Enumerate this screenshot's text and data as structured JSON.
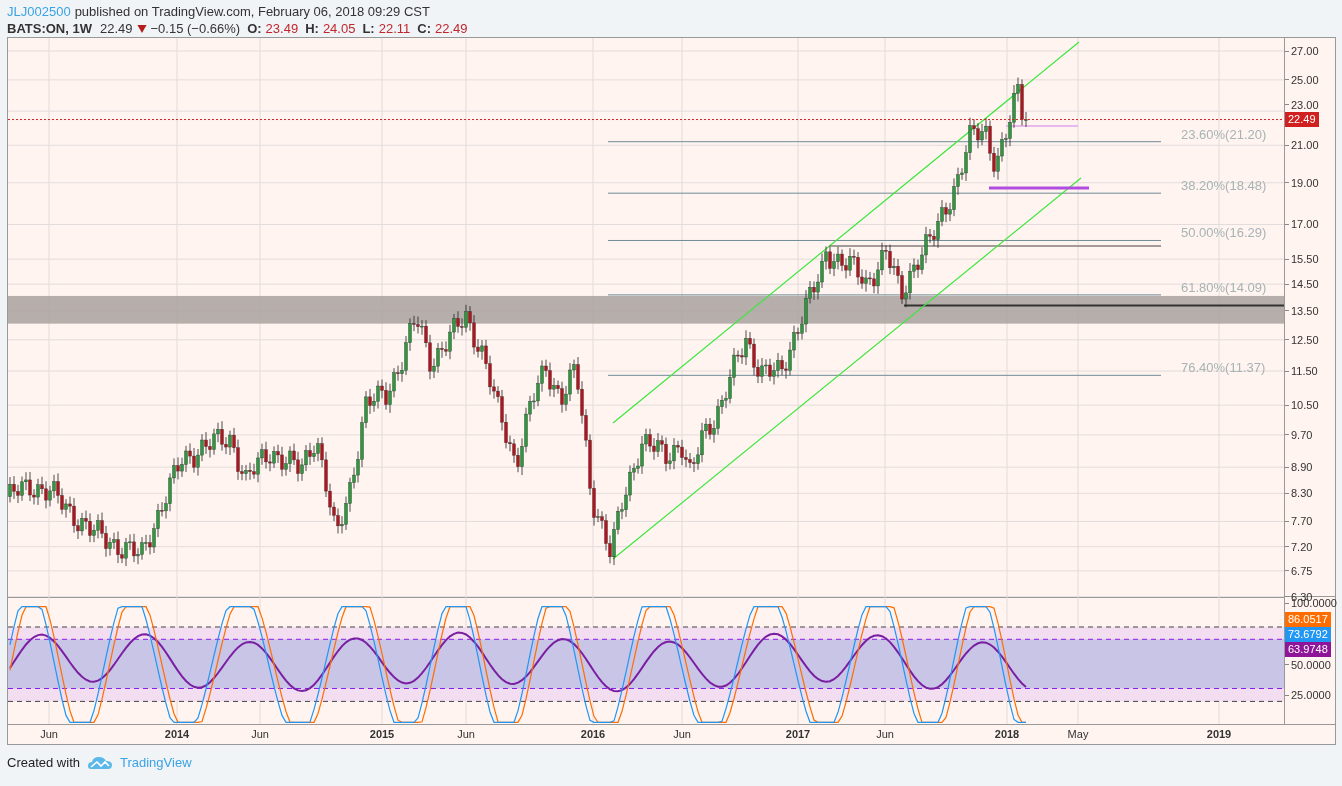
{
  "header": {
    "author": "JLJ002500",
    "published": "published on TradingView.com, February 06, 2018 09:29 CST"
  },
  "quote": {
    "symbol": "BATS:ON, 1W",
    "last": "22.49",
    "down": true,
    "change": "−0.15 (−0.66%)",
    "ohlc": [
      {
        "label": "O:",
        "value": "23.49"
      },
      {
        "label": "H:",
        "value": "24.05"
      },
      {
        "label": "L:",
        "value": "22.11"
      },
      {
        "label": "C:",
        "value": "22.49"
      }
    ]
  },
  "price_axis": {
    "ticks": [
      "27.00",
      "25.00",
      "23.00",
      "21.00",
      "19.00",
      "17.00",
      "15.50",
      "14.50",
      "13.50",
      "12.50",
      "11.50",
      "10.50",
      "9.70",
      "8.90",
      "8.30",
      "7.70",
      "7.20",
      "6.75",
      "6.30"
    ],
    "last_price": {
      "label": "22.49",
      "color": "#d0201f"
    }
  },
  "fib_levels": [
    {
      "label": "23.60%(21.20)"
    },
    {
      "label": "38.20%(18.48)"
    },
    {
      "label": "50.00%(16.29)"
    },
    {
      "label": "61.80%(14.09)"
    },
    {
      "label": "76.40%(11.37)"
    }
  ],
  "oscillator_axis": {
    "ticks": [
      "100.0000",
      "50.0000",
      "25.0000"
    ],
    "readings": [
      {
        "label": "86.0517",
        "color": "#ff6d00"
      },
      {
        "label": "73.6792",
        "color": "#2196f3"
      },
      {
        "label": "63.9748",
        "color": "#8e1599"
      }
    ]
  },
  "time_axis": [
    {
      "label": "Jun",
      "kind": "month"
    },
    {
      "label": "2014",
      "kind": "year"
    },
    {
      "label": "Jun",
      "kind": "month"
    },
    {
      "label": "2015",
      "kind": "year"
    },
    {
      "label": "Jun",
      "kind": "month"
    },
    {
      "label": "2016",
      "kind": "year"
    },
    {
      "label": "Jun",
      "kind": "month"
    },
    {
      "label": "2017",
      "kind": "year"
    },
    {
      "label": "Jun",
      "kind": "month"
    },
    {
      "label": "2018",
      "kind": "year"
    },
    {
      "label": "May",
      "kind": "month"
    },
    {
      "label": "2019",
      "kind": "year"
    }
  ],
  "footer": {
    "prefix": "Created with",
    "brand": "TradingView"
  }
}
